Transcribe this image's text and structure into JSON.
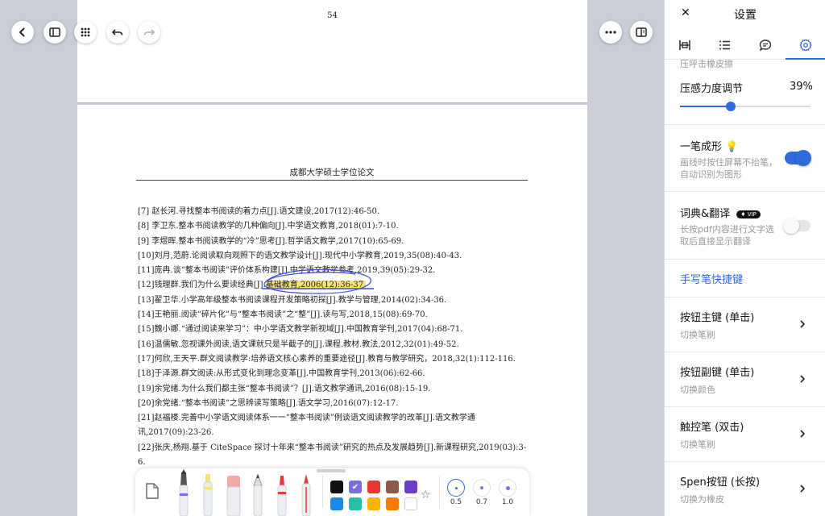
{
  "document": {
    "page_number": "54",
    "thesis_header": "成都大学硕士学位论文",
    "references": [
      "[7]  赵长河.寻找整本书阅读的着力点[J].语文建设,2017(12):46-50.",
      "[8]  李卫东.整本书阅读教学的几种偏向[J].中学语文教育,2018(01):7-10.",
      "[9]  李煜晖.整本书阅读教学的“冷”思考[J].哲学语文教学,2017(10):65-69.",
      "[10]刘月,范蔚.论阅读取向观照下的语文教学设计[J].现代中小学教育,2019,35(08):40-43.",
      "[11]庞冉.谈“整本书阅读”评价体系构建[J].中学语文教学参考,2019,39(05):29-32.",
      "[12]钱理群.我们为什么要读经典[J].",
      "[13]翟卫华.小学高年级整本书阅读课程开发策略初探[J].教学与管理,2014(02):34-36.",
      "[14]王艳丽.阅读“碎片化”与“整本书阅读”之“整”[J].读与写,2018,15(08):69-70.",
      "[15]魏小娜.“通过阅读来学习”：中小学语文教学新视域[J].中国教育学刊,2017(04):68-71.",
      "[16]温儒敏.忽视课外阅读,语文课就只是半截子的[J].课程.教材.教法,2012,32(01):49-52.",
      "[17]何欣,王天平.群文阅读教学:培养语文核心素养的重要途径[J].教育与教学研究，2018,32(1):112-116.",
      "[18]于泽源.群文阅读:从形式变化到理念变革[J].中国教育学刊,2013(06):62-66.",
      "[19]余党绪.为什么我们都主张“整本书阅读”？[J].语文教学通讯,2016(08):15-19.",
      "[20]余党绪.“整本书阅读”之思辨读写策略[J].语文学习,2016(07):12-17.",
      "[21]赵福楼.完善中小学语文阅读体系一一“整本书阅读”例谈语文阅读教学的改革[J].语文教学通讯,2017(09):23-26.",
      "[22]张庆,杨翔.基于 CiteSpace 探讨十年来“整本书阅读”研究的热点及发展趋势[J].新课程研究,2019(03):3-6."
    ],
    "ref12_highlight": "基础教育,2006(12):36-37."
  },
  "toolbar": {
    "stroke_sizes": [
      "0.5",
      "0.7",
      "1.0"
    ],
    "colors_row1": [
      "#111111",
      "#7b6fe0",
      "#e53935",
      "#8d5a4a",
      "#6a3fc8"
    ],
    "colors_row2": [
      "#1e88e5",
      "#26bfa8",
      "#f6b400",
      "#f57c00",
      "#ffffff"
    ],
    "selected_color": "#7b6fe0"
  },
  "panel": {
    "title": "设置",
    "clipped_text": "压呼击橡皮擦",
    "pressure": {
      "label": "压感力度调节",
      "value": "39%",
      "fraction": 0.39
    },
    "one_stroke": {
      "label": "一笔成形",
      "desc": "画线时按住屏幕不抬笔，自动识别为图形",
      "enabled": true
    },
    "dictionary": {
      "label": "词典&翻译",
      "badge": "VIP",
      "desc": "长按pdf内容进行文字选取后直接显示翻译",
      "enabled": false
    },
    "shortcuts_title": "手写笔快捷键",
    "shortcut_rows": [
      {
        "title": "按钮主键 (单击)",
        "sub": "切换笔刷"
      },
      {
        "title": "按钮副键 (单击)",
        "sub": "切换颜色"
      },
      {
        "title": "触控笔 (双击)",
        "sub": "切换笔刷"
      },
      {
        "title": "Spen按钮 (长按)",
        "sub": "切换为橡皮"
      }
    ]
  },
  "colors": {
    "accent": "#2f6bdc",
    "toggle_on": "#2f6bdc"
  }
}
